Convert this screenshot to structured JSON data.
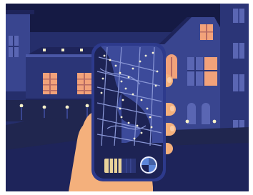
{
  "scene": {
    "kind": "illustration",
    "subject": "hand-holding-phone-night-city-map",
    "palette": {
      "sky": "#252e6b",
      "sky_top": "#151a44",
      "building_dark": "#2b3577",
      "building_mid": "#39458f",
      "building_light": "#4a57a6",
      "roof": "#1e245a",
      "window_lit": "#f2a27a",
      "window_lit_frame": "#b66a63",
      "window_dark": "#5a66b3",
      "street_lamp": "#f7f1c8",
      "ground": "#20264f",
      "phone_body": "#2d3a8c",
      "phone_screen": "#1d2354",
      "map_river": "#3c4a9a",
      "map_street": "#8a97d6",
      "map_light": "#fff6d6",
      "hand_skin": "#f4b07c",
      "hand_shadow": "#d98a5c",
      "hand_nail": "#f9cba5",
      "slider_track": "#e9d39a",
      "compass_blue": "#5c86d8",
      "compass_ring": "#eef0ff"
    },
    "icons": {
      "compass": "compass-icon",
      "slider": "slider-icon"
    }
  }
}
